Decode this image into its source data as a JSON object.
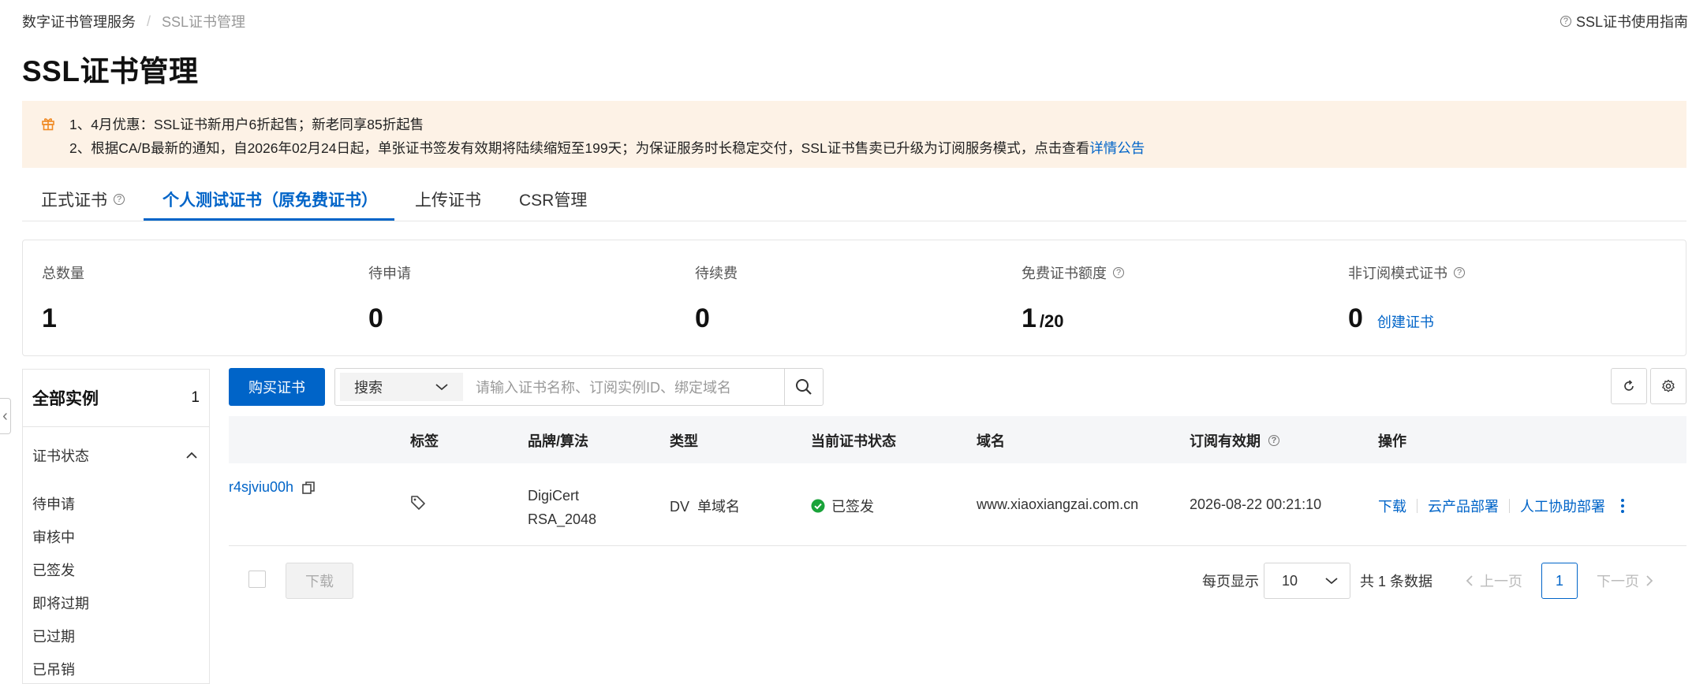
{
  "breadcrumb": {
    "root": "数字证书管理服务",
    "separator": "/",
    "current": "SSL证书管理"
  },
  "guide_link": "SSL证书使用指南",
  "page_title": "SSL证书管理",
  "notice": {
    "line1": "1、4月优惠：SSL证书新用户6折起售；新老同享85折起售",
    "line2": "2、根据CA/B最新的通知，自2026年02月24日起，单张证书签发有效期将陆续缩短至199天；为保证服务时长稳定交付，SSL证书售卖已升级为订阅服务模式，点击查看",
    "line2_link": "详情公告"
  },
  "tabs": [
    {
      "label": "正式证书"
    },
    {
      "label": "个人测试证书（原免费证书）"
    },
    {
      "label": "上传证书"
    },
    {
      "label": "CSR管理"
    }
  ],
  "stats": [
    {
      "label": "总数量",
      "value": "1"
    },
    {
      "label": "待申请",
      "value": "0"
    },
    {
      "label": "待续费",
      "value": "0"
    },
    {
      "label": "免费证书额度",
      "value": "1",
      "suffix": "/20"
    },
    {
      "label": "非订阅模式证书",
      "value": "0",
      "link": "创建证书"
    }
  ],
  "sidebar": {
    "all_label": "全部实例",
    "all_count": "1",
    "group_label": "证书状态",
    "items": [
      "待申请",
      "审核中",
      "已签发",
      "即将过期",
      "已过期",
      "已吊销"
    ]
  },
  "toolbar": {
    "buy_label": "购买证书",
    "search_select": "搜索",
    "search_placeholder": "请输入证书名称、订阅实例ID、绑定域名"
  },
  "table": {
    "headers": [
      "标签",
      "品牌/算法",
      "类型",
      "当前证书状态",
      "域名",
      "订阅有效期",
      "操作"
    ],
    "rows": [
      {
        "id": "r4sjviu00h",
        "brand": "DigiCert",
        "algo": "RSA_2048",
        "type": "DV  单域名",
        "status": "已签发",
        "domain": "www.xiaoxiangzai.com.cn",
        "expiry": "2026-08-22 00:21:10",
        "ops": [
          "下载",
          "云产品部署",
          "人工协助部署"
        ]
      }
    ]
  },
  "bottom": {
    "download_label": "下载",
    "per_page_label": "每页显示",
    "per_page_value": "10",
    "total_text": "共 1 条数据",
    "prev_label": "上一页",
    "page": "1",
    "next_label": "下一页"
  },
  "colors": {
    "accent": "#0064c8",
    "notice_bg": "#fdf2e6",
    "success": "#1aa33a"
  }
}
